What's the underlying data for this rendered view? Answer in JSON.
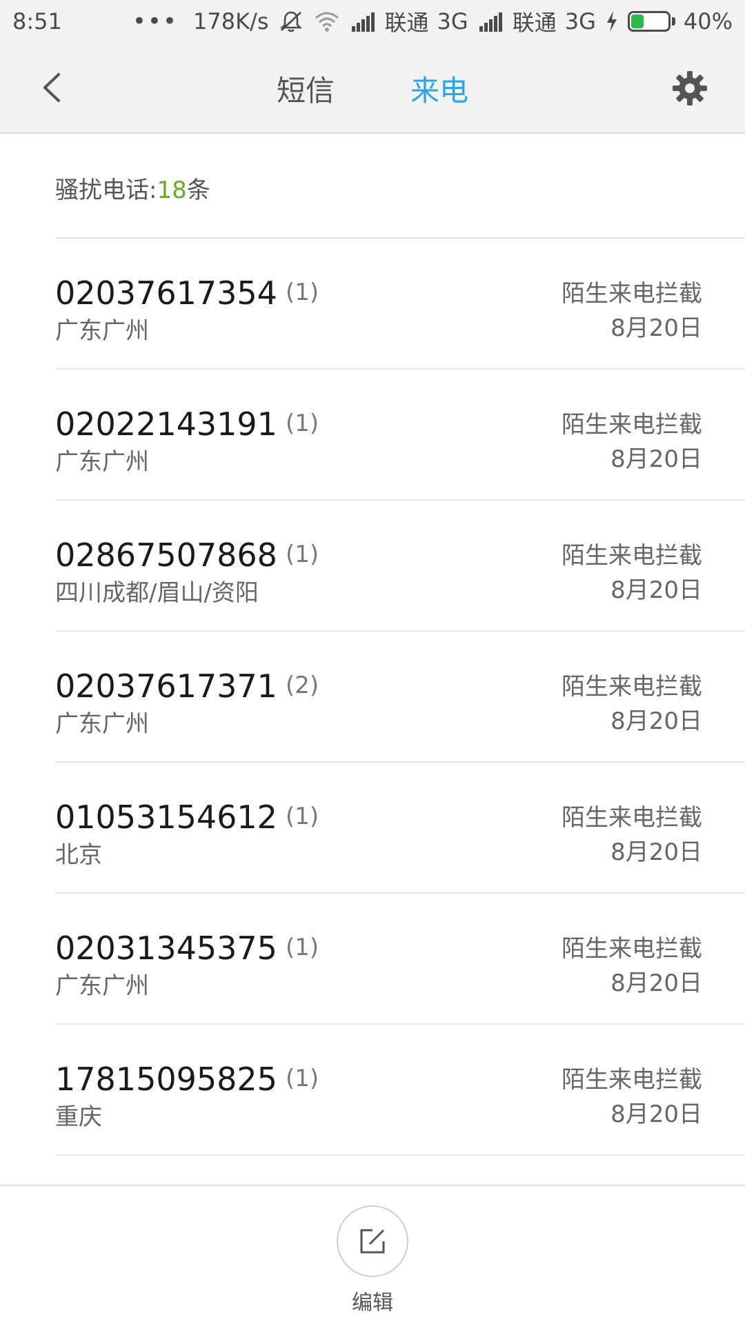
{
  "status_bar": {
    "time": "8:51",
    "dots": "•••",
    "speed": "178K/s",
    "carrier1": "联通",
    "net1": "3G",
    "carrier2": "联通",
    "net2": "3G",
    "battery_percent": "40%",
    "battery_level": 0.4,
    "icons": [
      "mute-icon",
      "wifi-icon",
      "signal-icon",
      "charging-icon",
      "battery-icon"
    ]
  },
  "header": {
    "tabs": [
      {
        "label": "短信",
        "active": false
      },
      {
        "label": "来电",
        "active": true
      }
    ],
    "icons": [
      "back-arrow-icon",
      "gear-icon"
    ]
  },
  "summary": {
    "prefix": "骚扰电话:",
    "count": "18",
    "suffix": "条"
  },
  "calls": [
    {
      "number": "02037617354",
      "count": "(1)",
      "location": "广东广州",
      "status": "陌生来电拦截",
      "date": "8月20日"
    },
    {
      "number": "02022143191",
      "count": "(1)",
      "location": "广东广州",
      "status": "陌生来电拦截",
      "date": "8月20日"
    },
    {
      "number": "02867507868",
      "count": "(1)",
      "location": "四川成都/眉山/资阳",
      "status": "陌生来电拦截",
      "date": "8月20日"
    },
    {
      "number": "02037617371",
      "count": "(2)",
      "location": "广东广州",
      "status": "陌生来电拦截",
      "date": "8月20日"
    },
    {
      "number": "01053154612",
      "count": "(1)",
      "location": "北京",
      "status": "陌生来电拦截",
      "date": "8月20日"
    },
    {
      "number": "02031345375",
      "count": "(1)",
      "location": "广东广州",
      "status": "陌生来电拦截",
      "date": "8月20日"
    },
    {
      "number": "17815095825",
      "count": "(1)",
      "location": "重庆",
      "status": "陌生来电拦截",
      "date": "8月20日"
    }
  ],
  "bottom": {
    "edit_label": "编辑",
    "icon": "edit-icon"
  },
  "colors": {
    "accent": "#2ea4e6",
    "count_green": "#6aad1c",
    "battery_green": "#2db84b"
  }
}
